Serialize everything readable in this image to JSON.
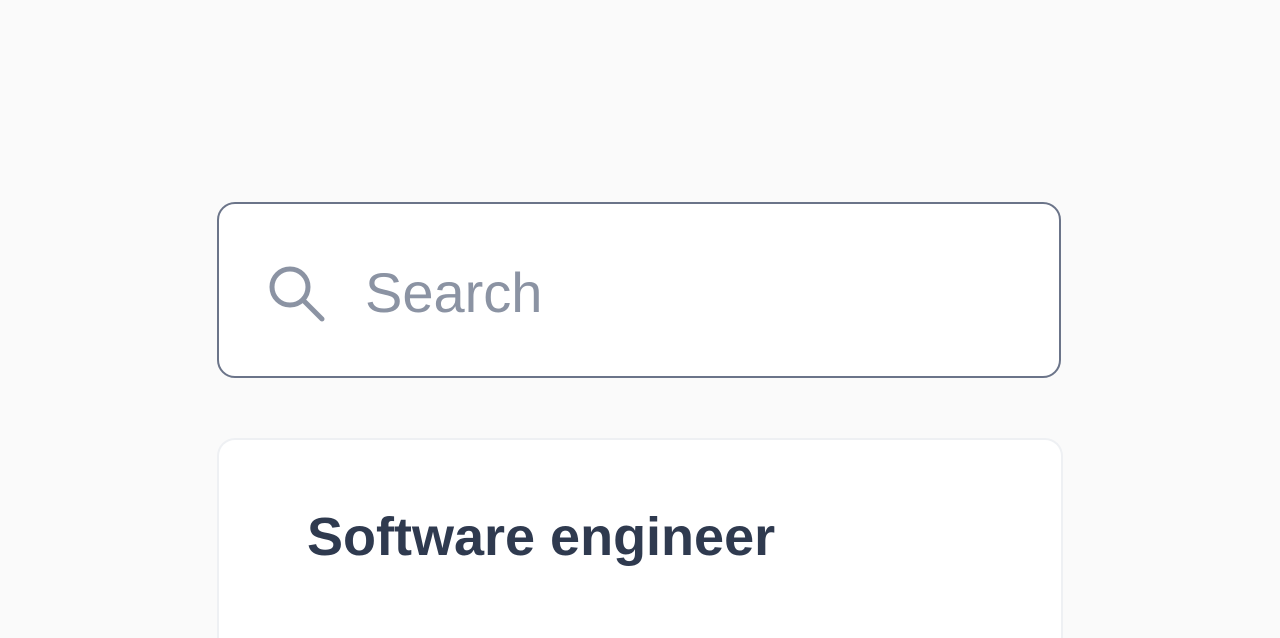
{
  "search": {
    "placeholder": "Search",
    "value": "",
    "icon": "search-icon"
  },
  "results": [
    {
      "title": "Software engineer"
    }
  ],
  "colors": {
    "page_background": "#fafafa",
    "input_border": "#6b7489",
    "placeholder_text": "#8b93a3",
    "title_text": "#2f3a4f",
    "card_border": "#eef0f3"
  }
}
